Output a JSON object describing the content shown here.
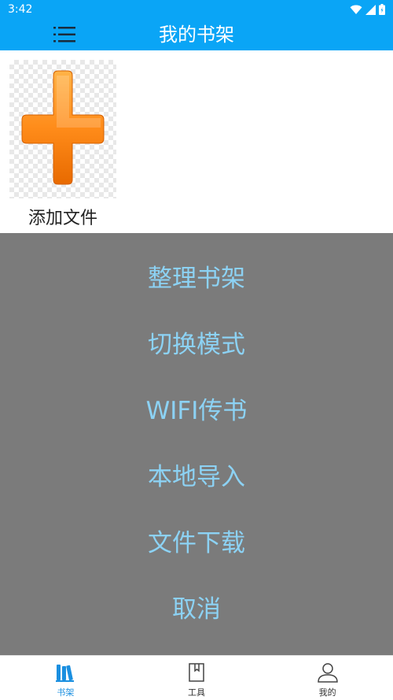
{
  "status_bar": {
    "time": "3:42"
  },
  "app_bar": {
    "title": "我的书架",
    "menu_icon": "menu-list-icon"
  },
  "shelf": {
    "add_file_label": "添加文件",
    "add_icon": "plus-icon"
  },
  "action_menu": {
    "items": [
      "整理书架",
      "切换模式",
      "WIFI传书",
      "本地导入",
      "文件下载"
    ],
    "cancel": "取消"
  },
  "tabs": [
    {
      "label": "书架",
      "icon": "bookshelf-icon",
      "active": true
    },
    {
      "label": "工具",
      "icon": "bookmark-book-icon",
      "active": false
    },
    {
      "label": "我的",
      "icon": "user-icon",
      "active": false
    }
  ],
  "colors": {
    "primary": "#0aa5f6",
    "overlay": "#7b7b7b",
    "menu_text": "#8cd2f4",
    "active_tab": "#1a8fe0"
  }
}
